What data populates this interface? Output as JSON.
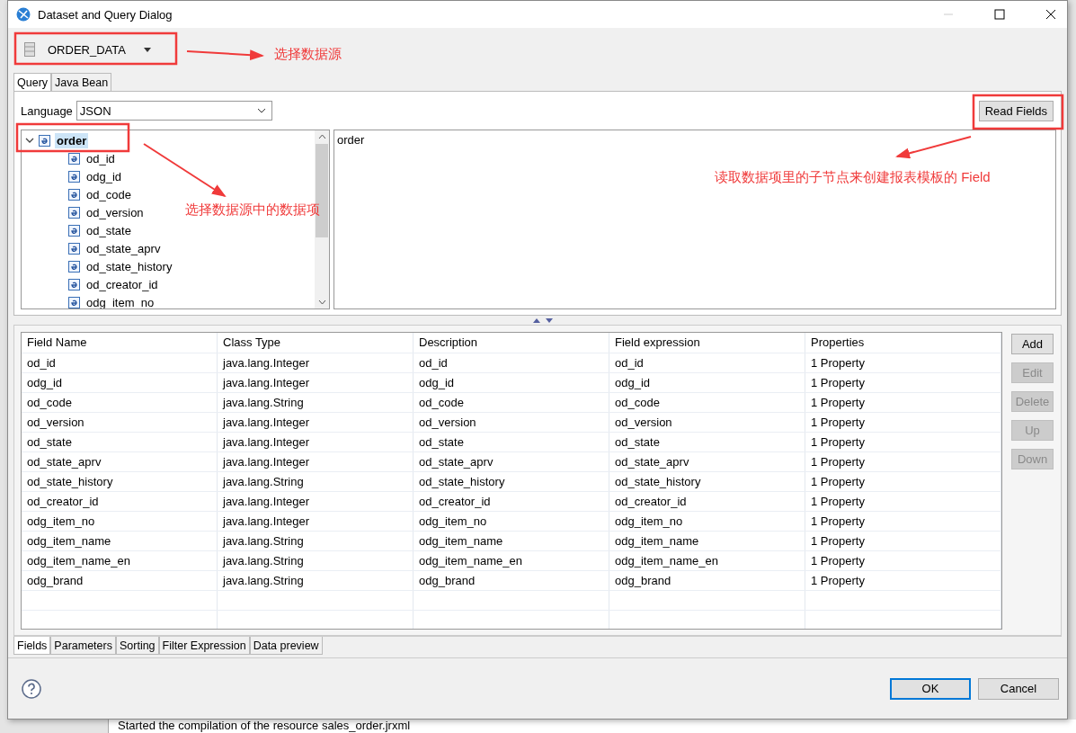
{
  "window": {
    "title": "Dataset and Query Dialog"
  },
  "data_adapter": {
    "value": "ORDER_DATA"
  },
  "query_tabs": [
    {
      "label": "Query",
      "selected": true
    },
    {
      "label": "Java Bean",
      "selected": false
    }
  ],
  "language": {
    "label": "Language",
    "value": "JSON"
  },
  "read_fields_button": "Read Fields",
  "tree": [
    {
      "label": "order",
      "expanded": true,
      "selected": true,
      "children": [
        {
          "label": "od_id"
        },
        {
          "label": "odg_id"
        },
        {
          "label": "od_code"
        },
        {
          "label": "od_version"
        },
        {
          "label": "od_state"
        },
        {
          "label": "od_state_aprv"
        },
        {
          "label": "od_state_history"
        },
        {
          "label": "od_creator_id"
        },
        {
          "label": "odg_item_no"
        }
      ]
    }
  ],
  "query_text": "order",
  "table": {
    "columns": [
      "Field Name",
      "Class Type",
      "Description",
      "Field expression",
      "Properties"
    ],
    "rows": [
      [
        "od_id",
        "java.lang.Integer",
        "od_id",
        "od_id",
        "1 Property"
      ],
      [
        "odg_id",
        "java.lang.Integer",
        "odg_id",
        "odg_id",
        "1 Property"
      ],
      [
        "od_code",
        "java.lang.String",
        "od_code",
        "od_code",
        "1 Property"
      ],
      [
        "od_version",
        "java.lang.Integer",
        "od_version",
        "od_version",
        "1 Property"
      ],
      [
        "od_state",
        "java.lang.Integer",
        "od_state",
        "od_state",
        "1 Property"
      ],
      [
        "od_state_aprv",
        "java.lang.Integer",
        "od_state_aprv",
        "od_state_aprv",
        "1 Property"
      ],
      [
        "od_state_history",
        "java.lang.String",
        "od_state_history",
        "od_state_history",
        "1 Property"
      ],
      [
        "od_creator_id",
        "java.lang.Integer",
        "od_creator_id",
        "od_creator_id",
        "1 Property"
      ],
      [
        "odg_item_no",
        "java.lang.Integer",
        "odg_item_no",
        "odg_item_no",
        "1 Property"
      ],
      [
        "odg_item_name",
        "java.lang.String",
        "odg_item_name",
        "odg_item_name",
        "1 Property"
      ],
      [
        "odg_item_name_en",
        "java.lang.String",
        "odg_item_name_en",
        "odg_item_name_en",
        "1 Property"
      ],
      [
        "odg_brand",
        "java.lang.String",
        "odg_brand",
        "odg_brand",
        "1 Property"
      ]
    ]
  },
  "side_buttons": [
    {
      "label": "Add",
      "disabled": false
    },
    {
      "label": "Edit",
      "disabled": true
    },
    {
      "label": "Delete",
      "disabled": true
    },
    {
      "label": "Up",
      "disabled": true
    },
    {
      "label": "Down",
      "disabled": true
    }
  ],
  "bottom_tabs": [
    {
      "label": "Fields",
      "selected": true
    },
    {
      "label": "Parameters",
      "selected": false
    },
    {
      "label": "Sorting",
      "selected": false
    },
    {
      "label": "Filter Expression",
      "selected": false
    },
    {
      "label": "Data preview",
      "selected": false
    }
  ],
  "dialog_buttons": [
    "OK",
    "Cancel"
  ],
  "annotations": [
    {
      "text": "选择数据源"
    },
    {
      "text": "选择数据源中的数据项"
    },
    {
      "text": "读取数据项里的子节点来创建报表模板的 Field"
    }
  ],
  "console_line": "Started the compilation of the resource sales_order.jrxml"
}
